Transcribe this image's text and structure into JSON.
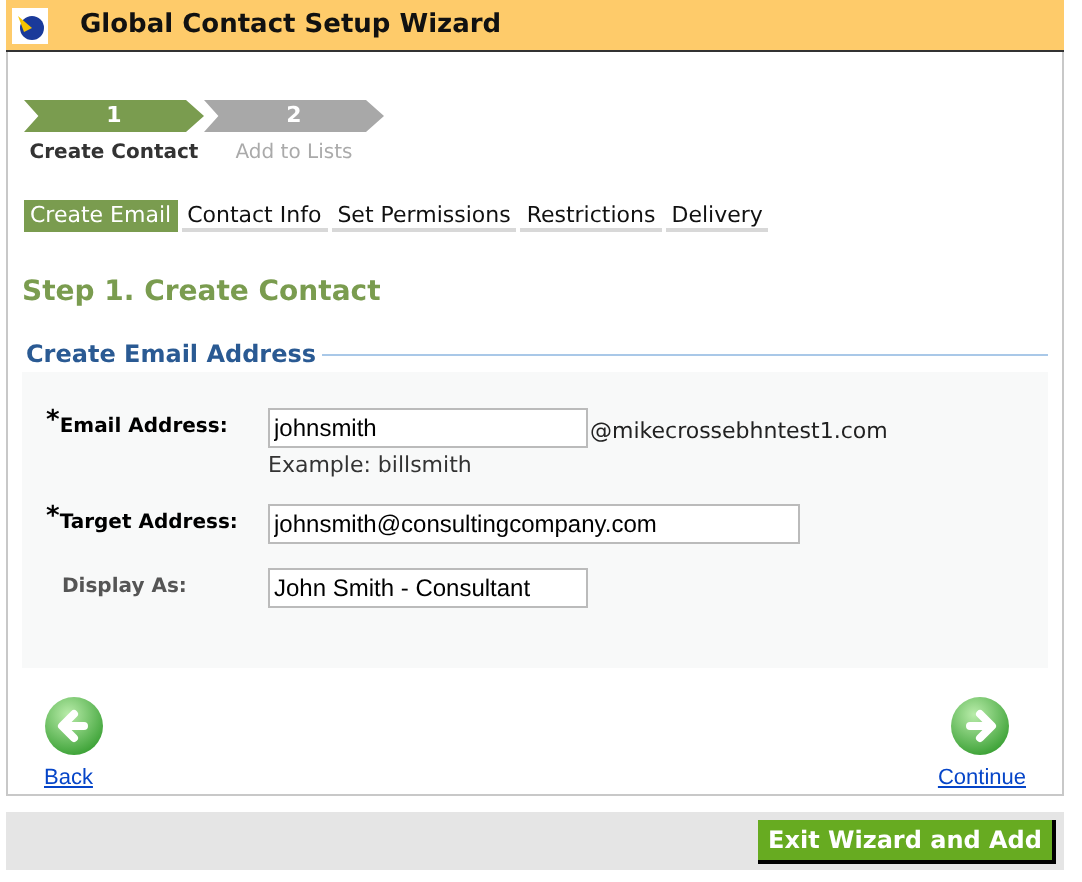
{
  "window": {
    "title": "Global Contact Setup Wizard"
  },
  "steps": [
    {
      "number": "1",
      "label": "Create Contact",
      "selected": true
    },
    {
      "number": "2",
      "label": "Add to Lists",
      "selected": false
    }
  ],
  "tabs": [
    {
      "label": "Create Email",
      "selected": true
    },
    {
      "label": "Contact Info",
      "selected": false
    },
    {
      "label": "Set Permissions",
      "selected": false
    },
    {
      "label": "Restrictions",
      "selected": false
    },
    {
      "label": "Delivery",
      "selected": false
    }
  ],
  "heading": "Step 1. Create Contact",
  "section": {
    "title": "Create Email Address",
    "fields": [
      {
        "mark": "*",
        "label": "Email Address:",
        "required": true,
        "value": "johnsmith",
        "suffix": "@mikecrossebhntest1.com",
        "hint": "Example: billsmith"
      },
      {
        "mark": "*",
        "label": "Target Address:",
        "required": true,
        "value": "johnsmith@consultingcompany.com"
      },
      {
        "label": "Display As:",
        "required": false,
        "value": "John Smith - Consultant"
      }
    ]
  },
  "nav": {
    "back": "Back",
    "continue": "Continue"
  },
  "footer": {
    "button": "Exit Wizard and Add"
  }
}
